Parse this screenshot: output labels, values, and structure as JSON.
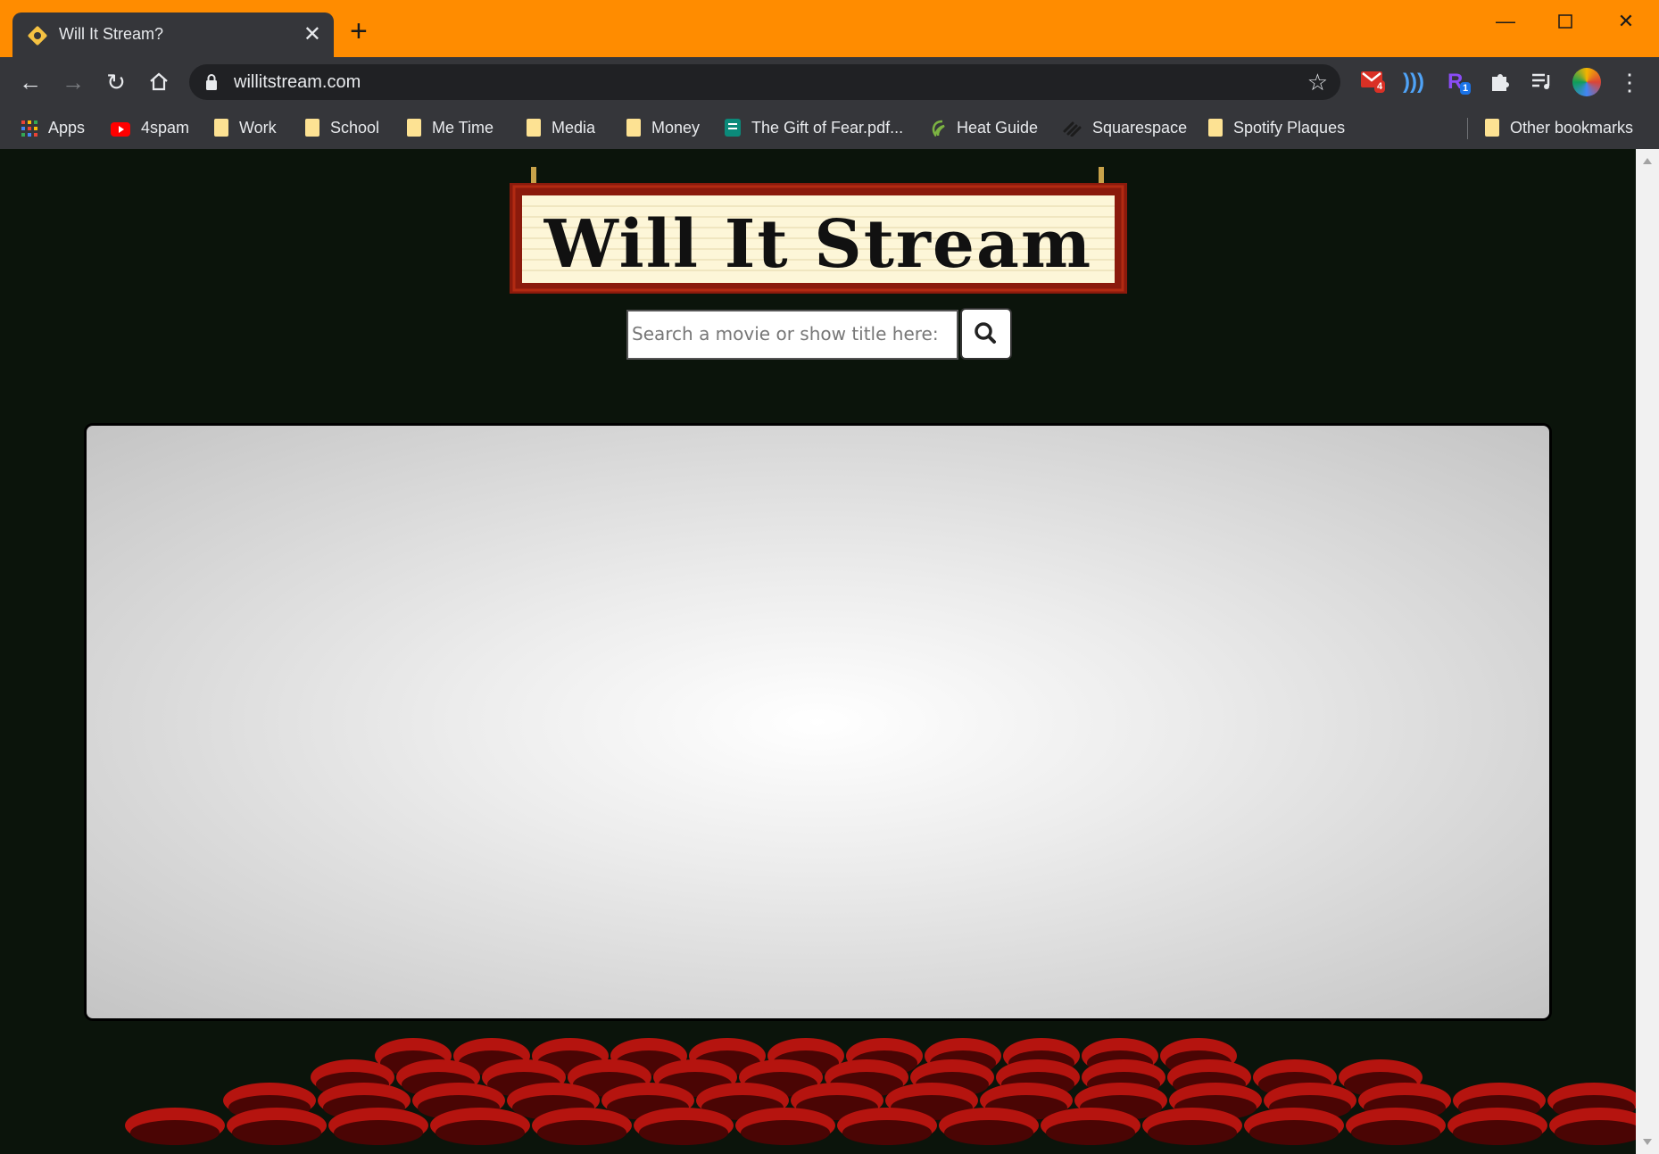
{
  "browser": {
    "tab_title": "Will It Stream?",
    "new_tab_label": "+",
    "url": "willitstream.com",
    "extensions": [
      {
        "name": "gmail-icon",
        "badge": "4"
      },
      {
        "name": "wave-icon",
        "badge": ""
      },
      {
        "name": "rakuten-icon",
        "badge": "1"
      },
      {
        "name": "puzzle-icon",
        "badge": ""
      },
      {
        "name": "playlist-icon",
        "badge": ""
      }
    ],
    "bookmarks": [
      {
        "label": "Apps",
        "icon": "apps-grid-icon"
      },
      {
        "label": "4spam",
        "icon": "youtube-icon"
      },
      {
        "label": "Work",
        "icon": "folder-icon"
      },
      {
        "label": "School",
        "icon": "folder-icon"
      },
      {
        "label": "Me Time",
        "icon": "folder-icon"
      },
      {
        "label": "Media",
        "icon": "folder-icon"
      },
      {
        "label": "Money",
        "icon": "folder-icon"
      },
      {
        "label": "The Gift of Fear.pdf...",
        "icon": "document-icon"
      },
      {
        "label": "Heat Guide",
        "icon": "leaf-icon"
      },
      {
        "label": "Squarespace",
        "icon": "squarespace-icon"
      },
      {
        "label": "Spotify Plaques",
        "icon": "folder-icon"
      }
    ],
    "other_bookmarks": "Other bookmarks",
    "colors": {
      "titlebar": "#ff8c00",
      "toolbar": "#35363a",
      "omnibox": "#202124"
    }
  },
  "page": {
    "logo_text": "Will It Stream",
    "search": {
      "placeholder": "Search a movie or show title here:",
      "value": ""
    },
    "colors": {
      "background": "#0b140b",
      "sign_frame": "#8b1a0c",
      "seat": "#b5140f"
    }
  }
}
